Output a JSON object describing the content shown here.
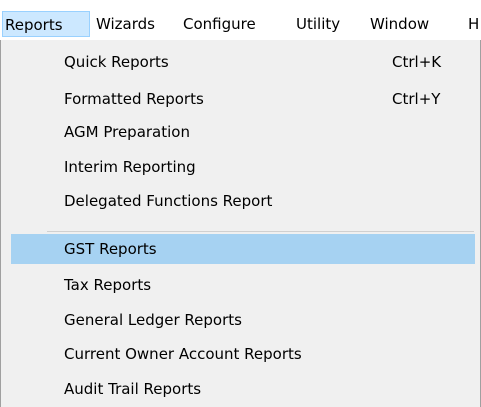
{
  "menubar": {
    "items": [
      "Reports",
      "Wizards",
      "Configure",
      "Utility",
      "Window",
      "H"
    ]
  },
  "reports_menu": {
    "items": [
      {
        "label": "Quick  Reports",
        "shortcut": "Ctrl+K"
      },
      {
        "label": "Formatted Reports",
        "shortcut": "Ctrl+Y"
      },
      {
        "label": "AGM Preparation",
        "shortcut": ""
      },
      {
        "label": "Interim Reporting",
        "shortcut": ""
      },
      {
        "label": "Delegated Functions Report",
        "shortcut": ""
      },
      {
        "label": "GST Reports",
        "shortcut": ""
      },
      {
        "label": "Tax Reports",
        "shortcut": ""
      },
      {
        "label": "General Ledger Reports",
        "shortcut": ""
      },
      {
        "label": "Current Owner Account Reports",
        "shortcut": ""
      },
      {
        "label": "Audit Trail Reports",
        "shortcut": ""
      }
    ],
    "highlighted_item": "GST Reports"
  },
  "colors": {
    "menu_background": "#f0f0f0",
    "highlight": "#a6d2f2",
    "active_menubar_item": "#cce8ff"
  }
}
